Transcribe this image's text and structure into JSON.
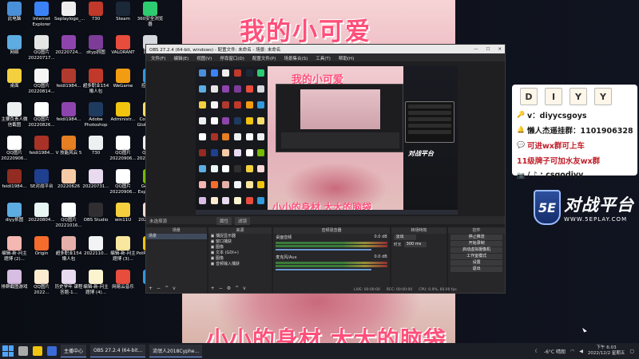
{
  "stream_overlay": {
    "banner_top": "我的小可爱",
    "banner_bottom": "小小的身材 大大的脑袋"
  },
  "desktop_icons": [
    {
      "label": "此电脑",
      "color": "#4a90d9"
    },
    {
      "label": "Internet Explorer",
      "color": "#3b82f6"
    },
    {
      "label": "Seplaylogo_...",
      "color": "#eeeeee"
    },
    {
      "label": "730",
      "color": "#c0392b"
    },
    {
      "label": "Steam",
      "color": "#1b2838"
    },
    {
      "label": "360安全浏览器",
      "color": "#2ecc71"
    },
    {
      "label": "网络",
      "color": "#5dade2"
    },
    {
      "label": "QQ图片 20220717...",
      "color": "#e5e5e5"
    },
    {
      "label": "20220724...",
      "color": "#8e44ad"
    },
    {
      "label": "dtyp抓图",
      "color": "#7d3c98"
    },
    {
      "label": "VALORANT",
      "color": "#e74c3c"
    },
    {
      "label": "回收站",
      "color": "#d5d8dc"
    },
    {
      "label": "桌面",
      "color": "#f4d03f"
    },
    {
      "label": "QQ图片 20220814...",
      "color": "#f5f5f5"
    },
    {
      "label": "feidi1984...",
      "color": "#b03a2e"
    },
    {
      "label": "超多职业154 懒人包",
      "color": "#c0392b"
    },
    {
      "label": "WeGame",
      "color": "#f39c12"
    },
    {
      "label": "控制面板",
      "color": "#3498db"
    },
    {
      "label": "主要负责人微信截图",
      "color": "#ecf0f1"
    },
    {
      "label": "QQ图片 20220826...",
      "color": "#fdfefe"
    },
    {
      "label": "feidi1984...",
      "color": "#8e44ad"
    },
    {
      "label": "Adobe Photoshop",
      "color": "#1f3a5f"
    },
    {
      "label": "Administr...",
      "color": "#f1c40f"
    },
    {
      "label": "Counter-S Global Off...",
      "color": "#f7dc6f"
    },
    {
      "label": "QQ图片 20220906...",
      "color": "#ffffff"
    },
    {
      "label": "feidi1984...",
      "color": "#a93226"
    },
    {
      "label": "V 技能风云 5",
      "color": "#e67e22"
    },
    {
      "label": "730",
      "color": "#ecf0f1"
    },
    {
      "label": "QQ图片 20220906...",
      "color": "#ffffff"
    },
    {
      "label": "QQ图片 20220909...",
      "color": "#ecf0f1"
    },
    {
      "label": "feidi1984...",
      "color": "#922b21"
    },
    {
      "label": "SE对战平台",
      "color": "#1f3f8f"
    },
    {
      "label": "20220626",
      "color": "#f5cba7"
    },
    {
      "label": "20220731...",
      "color": "#e8daef"
    },
    {
      "label": "QQ图片 20220906...",
      "color": "#ffffff"
    },
    {
      "label": "GeForce Experience",
      "color": "#76b900"
    },
    {
      "label": "diyy抓图",
      "color": "#5dade2"
    },
    {
      "label": "20220804...",
      "color": "#e8f6f3"
    },
    {
      "label": "QQ图片 20221016...",
      "color": "#fdfefe"
    },
    {
      "label": "OBS Studio",
      "color": "#302e31"
    },
    {
      "label": "win11U",
      "color": "#f4d03f"
    },
    {
      "label": "2022106...",
      "color": "#fadbd8"
    },
    {
      "label": "编辑-新-问主 题博 (2)...",
      "color": "#f5b7b1"
    },
    {
      "label": "Origin",
      "color": "#f56c2d"
    },
    {
      "label": "超多职业154 懒人包",
      "color": "#e6b0aa"
    },
    {
      "label": "2022110...",
      "color": "#f2f3f4"
    },
    {
      "label": "编辑-新-问主 题博 (3)...",
      "color": "#f9e79f"
    },
    {
      "label": "PotPlayer 64 bit",
      "color": "#f1c40f"
    },
    {
      "label": "排群截图游戏",
      "color": "#d7bde2"
    },
    {
      "label": "QQ图片 2022...",
      "color": "#fdebd0"
    },
    {
      "label": "历史学年 课程 答题-1...",
      "color": "#e8daef"
    },
    {
      "label": "编辑-新-问主 题博 (4)...",
      "color": "#fcf3cf"
    },
    {
      "label": "网易云音乐",
      "color": "#e74c3c"
    },
    {
      "label": "恋爱",
      "color": "#3498db"
    }
  ],
  "obs": {
    "window_title": "OBS 27.2.4 (64-bit, windows) - 配置文件: 未命名 - 场景: 未命名",
    "menu": [
      "文件(F)",
      "编辑(E)",
      "视图(V)",
      "停靠窗口(D)",
      "配置文件(P)",
      "场景集合(S)",
      "工具(T)",
      "帮助(H)"
    ],
    "preview_mini_title": "我的小可爱",
    "preview_mini_bottom": "小小的身材 大大的脑袋",
    "source_bar_label": "未选择源",
    "source_bar_tabs": [
      "属性",
      "滤镜"
    ],
    "docks": {
      "scenes": {
        "header": "场景",
        "items": [
          "场景"
        ],
        "tools": [
          "+",
          "−",
          "^",
          "v"
        ]
      },
      "sources": {
        "header": "来源",
        "items": [
          "捕捉显示器",
          "窗口捕获",
          "图像",
          "文本 (GDI+)",
          "图像",
          "音频输入捕获"
        ],
        "tools": [
          "+",
          "−",
          "⚙",
          "^",
          "v"
        ]
      },
      "mixer": {
        "header": "音频混音器",
        "channels": [
          {
            "name": "桌面音频",
            "level": "0.0 dB"
          },
          {
            "name": "麦克风/Aux",
            "level": "0.0 dB"
          }
        ]
      },
      "transitions": {
        "header": "转场特效",
        "type": "淡出",
        "duration_label": "时长",
        "duration": "300 ms"
      },
      "controls": {
        "header": "控件",
        "buttons": [
          "停止推流",
          "开始录制",
          "启动虚拟摄像机",
          "工作室模式",
          "设置",
          "退出"
        ]
      }
    },
    "status": [
      "LIVE: 00:00:00",
      "REC: 00:00:00",
      "CPU: 0.9%, 60.00 fps"
    ]
  },
  "info_card": {
    "letters": [
      "D",
      "I",
      "Y",
      "Y"
    ],
    "lines": [
      {
        "icon": "🔑",
        "text": "v：diyycsgoys",
        "style": "plain"
      },
      {
        "icon": "🔔",
        "text": "懒人杰遥挂群：1101906328",
        "style": "plain"
      },
      {
        "icon": "💬",
        "text": "可进wx群可上车",
        "style": "red"
      },
      {
        "icon": "",
        "text": "11级牌子可加水友wx群",
        "style": "red"
      },
      {
        "icon": "📷",
        "text": "/ ♪ : csgodiyy",
        "style": "plain"
      }
    ]
  },
  "logo": {
    "badge": "5E",
    "big": "对战平台",
    "small": "WWW.5EPLAY.COM"
  },
  "taskbar": {
    "tasks": [
      "主播中心",
      "OBS 27.2.4 (64-bit...",
      "流氓人2018Cyphe..."
    ],
    "weather": "-6°C 晴朗",
    "time": "下午 6:03",
    "date": "2022/12/2 星期五"
  }
}
